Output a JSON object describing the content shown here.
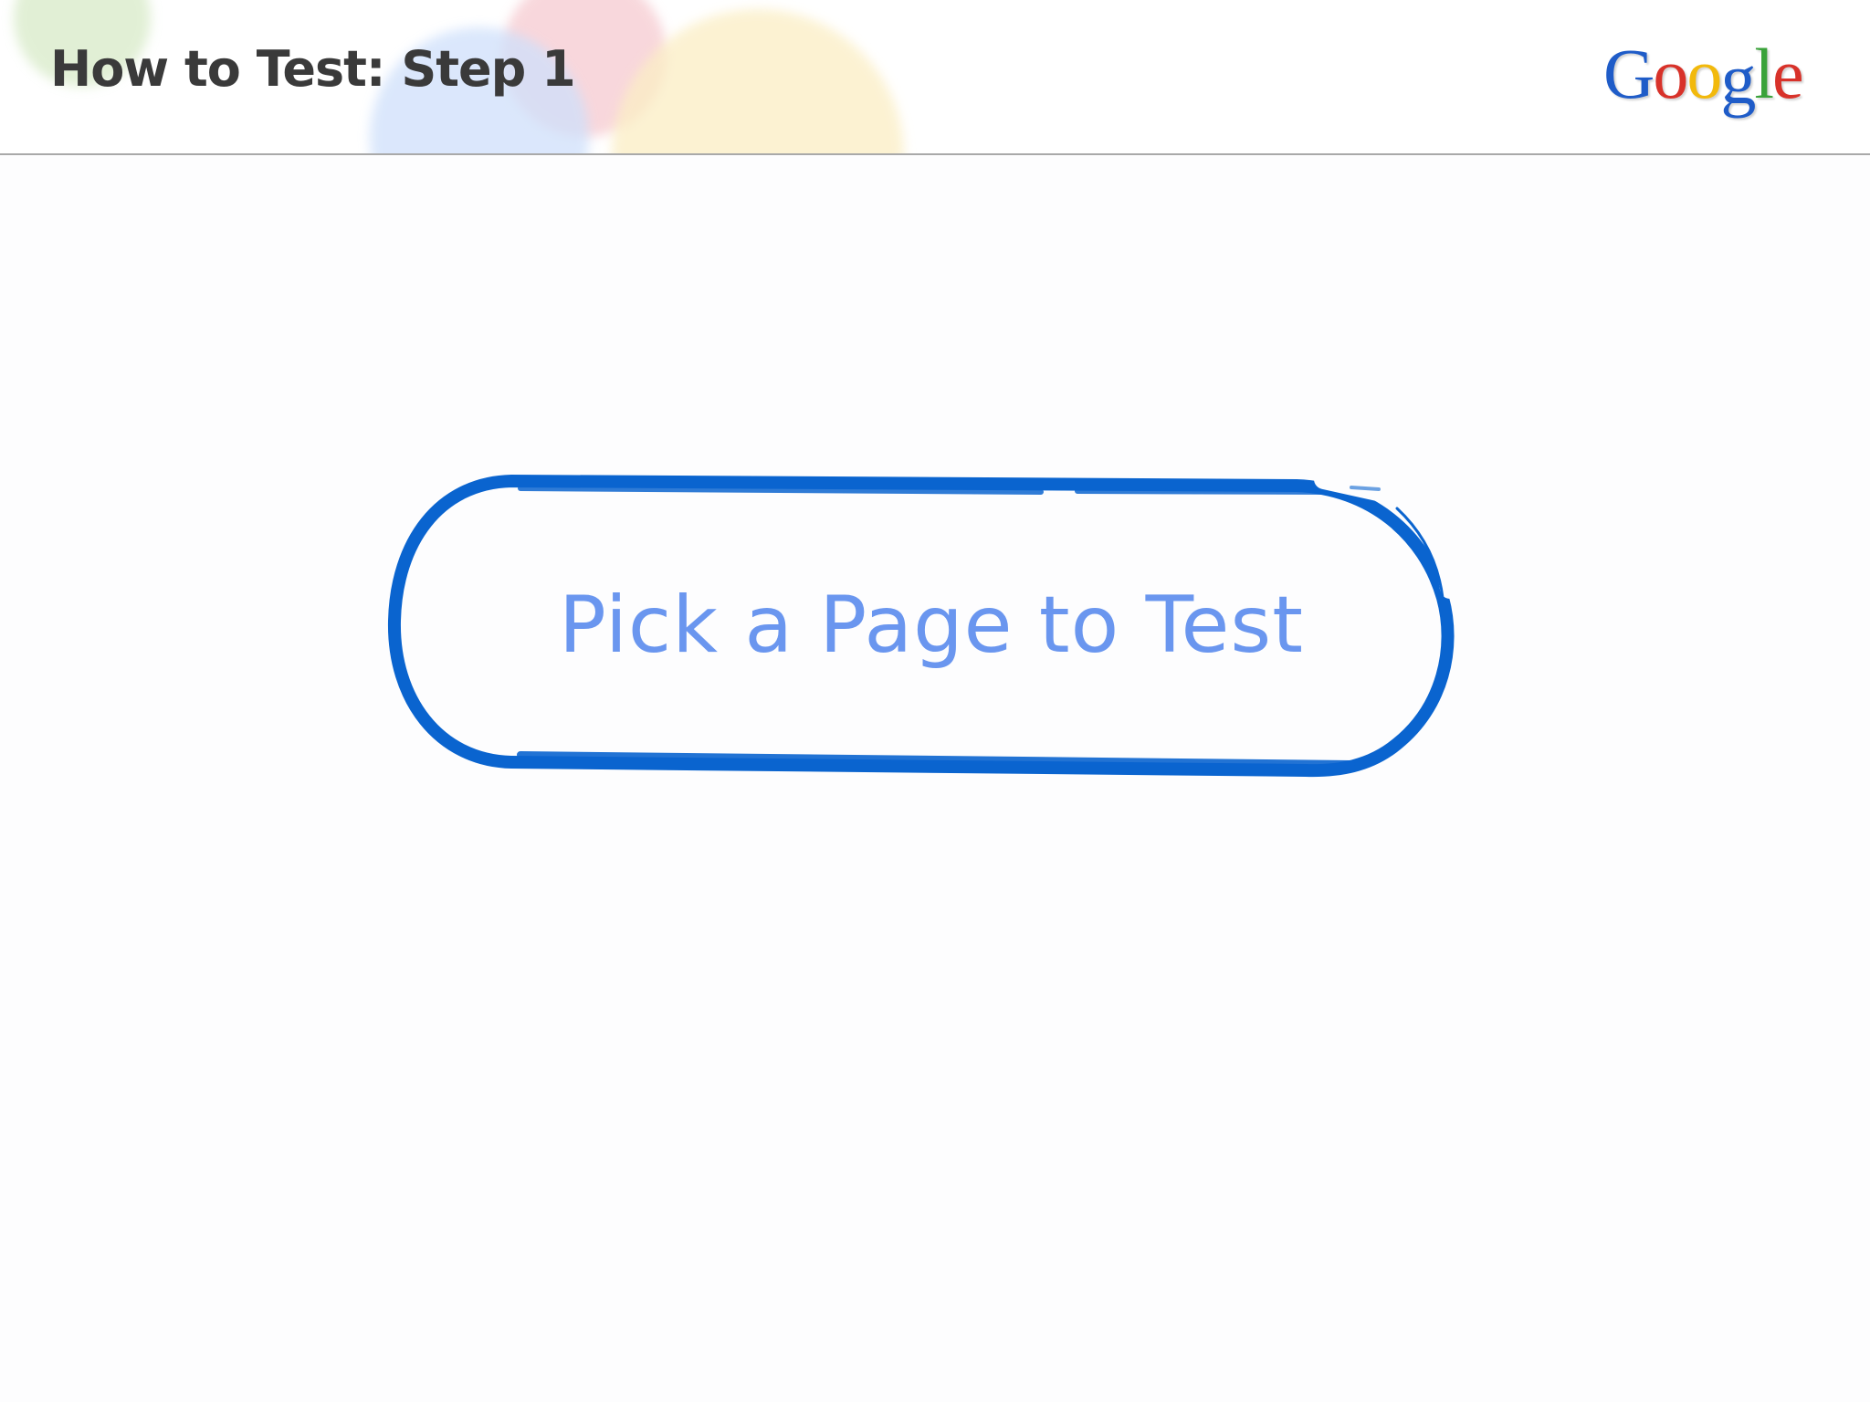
{
  "slide": {
    "title": "How to Test: Step 1"
  },
  "logo": {
    "letters": [
      {
        "char": "G",
        "color": "#1f5cc8"
      },
      {
        "char": "o",
        "color": "#d8322a"
      },
      {
        "char": "o",
        "color": "#f2b90c"
      },
      {
        "char": "g",
        "color": "#1f5cc8"
      },
      {
        "char": "l",
        "color": "#3aa23a"
      },
      {
        "char": "e",
        "color": "#d8322a"
      }
    ]
  },
  "callout": {
    "label": "Pick a Page to Test",
    "stroke_color": "#0a64cf",
    "text_color": "#6a96ef"
  }
}
